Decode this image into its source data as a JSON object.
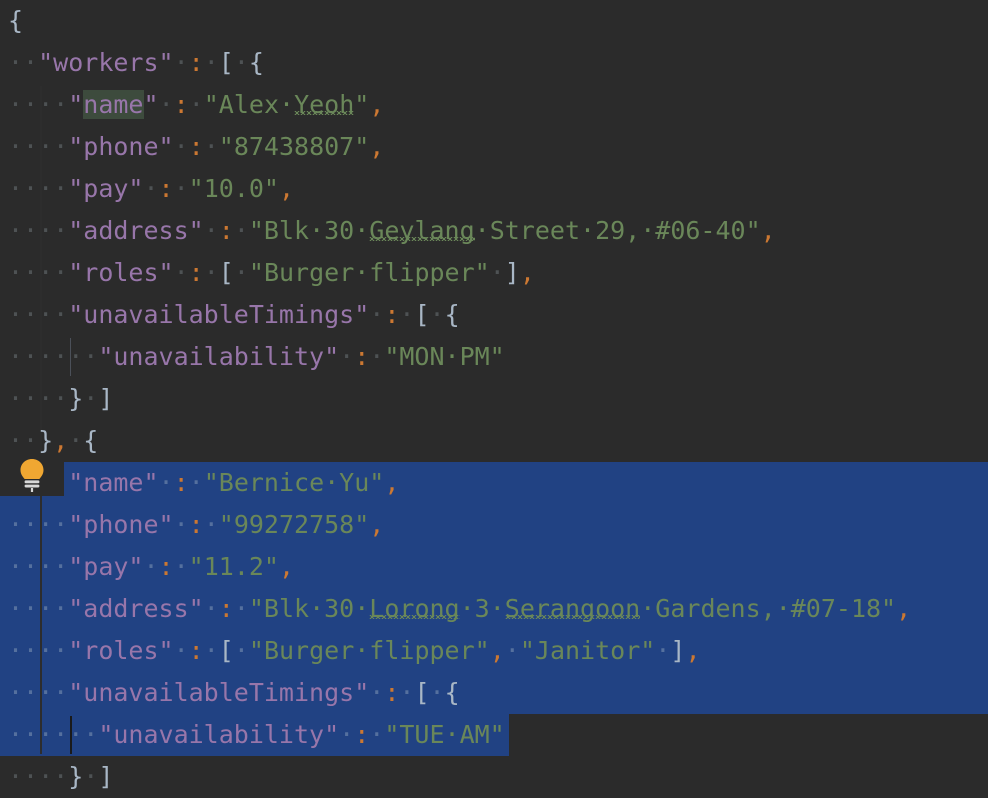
{
  "app": {
    "kind": "json-code-editor",
    "theme": "darcula",
    "background_color": "#2b2b2b",
    "selection_color": "#214283",
    "key_color": "#9876aa",
    "string_color": "#6a8759",
    "punctuation_color": "#cc7832",
    "brace_color": "#a9b7c6",
    "whitespace_dot_color": "#4e5254",
    "identifier_highlight_color": "#3d4b3d",
    "spellcheck_underline_color": "#6a8759",
    "font_size_px": 25,
    "line_height_px": 42
  },
  "gutter": {
    "intention_bulb": {
      "icon": "lightbulb-icon",
      "label": "Show Context Actions",
      "color": "#f0a732",
      "line_index": 11
    }
  },
  "editor": {
    "lines": [
      {
        "index": 0,
        "indent": 0,
        "selected": false,
        "tokens": [
          {
            "t": "brace",
            "v": "{"
          }
        ]
      },
      {
        "index": 1,
        "indent": 1,
        "selected": false,
        "tokens": [
          {
            "t": "key",
            "v": "\"workers\""
          },
          {
            "t": "ws",
            "v": "·"
          },
          {
            "t": "punc",
            "v": ":"
          },
          {
            "t": "ws",
            "v": "·"
          },
          {
            "t": "brace",
            "v": "["
          },
          {
            "t": "ws",
            "v": "·"
          },
          {
            "t": "brace",
            "v": "{"
          }
        ]
      },
      {
        "index": 2,
        "indent": 2,
        "selected": false,
        "tokens": [
          {
            "t": "key",
            "v": "\""
          },
          {
            "t": "key-hl",
            "v": "name"
          },
          {
            "t": "key",
            "v": "\""
          },
          {
            "t": "ws",
            "v": "·"
          },
          {
            "t": "punc",
            "v": ":"
          },
          {
            "t": "ws",
            "v": "·"
          },
          {
            "t": "str",
            "v": "\"Alex·"
          },
          {
            "t": "str-spell",
            "v": "Yeoh"
          },
          {
            "t": "str",
            "v": "\""
          },
          {
            "t": "punc",
            "v": ","
          }
        ]
      },
      {
        "index": 3,
        "indent": 2,
        "selected": false,
        "tokens": [
          {
            "t": "key",
            "v": "\"phone\""
          },
          {
            "t": "ws",
            "v": "·"
          },
          {
            "t": "punc",
            "v": ":"
          },
          {
            "t": "ws",
            "v": "·"
          },
          {
            "t": "str",
            "v": "\"87438807\""
          },
          {
            "t": "punc",
            "v": ","
          }
        ]
      },
      {
        "index": 4,
        "indent": 2,
        "selected": false,
        "tokens": [
          {
            "t": "key",
            "v": "\"pay\""
          },
          {
            "t": "ws",
            "v": "·"
          },
          {
            "t": "punc",
            "v": ":"
          },
          {
            "t": "ws",
            "v": "·"
          },
          {
            "t": "str",
            "v": "\"10.0\""
          },
          {
            "t": "punc",
            "v": ","
          }
        ]
      },
      {
        "index": 5,
        "indent": 2,
        "selected": false,
        "tokens": [
          {
            "t": "key",
            "v": "\"address\""
          },
          {
            "t": "ws",
            "v": "·"
          },
          {
            "t": "punc",
            "v": ":"
          },
          {
            "t": "ws",
            "v": "·"
          },
          {
            "t": "str",
            "v": "\"Blk·30·"
          },
          {
            "t": "str-spell",
            "v": "Geylang"
          },
          {
            "t": "str",
            "v": "·Street·29,·#06-40\""
          },
          {
            "t": "punc",
            "v": ","
          }
        ]
      },
      {
        "index": 6,
        "indent": 2,
        "selected": false,
        "tokens": [
          {
            "t": "key",
            "v": "\"roles\""
          },
          {
            "t": "ws",
            "v": "·"
          },
          {
            "t": "punc",
            "v": ":"
          },
          {
            "t": "ws",
            "v": "·"
          },
          {
            "t": "brace",
            "v": "["
          },
          {
            "t": "ws",
            "v": "·"
          },
          {
            "t": "str",
            "v": "\"Burger·flipper\""
          },
          {
            "t": "ws",
            "v": "·"
          },
          {
            "t": "brace",
            "v": "]"
          },
          {
            "t": "punc",
            "v": ","
          }
        ]
      },
      {
        "index": 7,
        "indent": 2,
        "selected": false,
        "tokens": [
          {
            "t": "key",
            "v": "\"unavailableTimings\""
          },
          {
            "t": "ws",
            "v": "·"
          },
          {
            "t": "punc",
            "v": ":"
          },
          {
            "t": "ws",
            "v": "·"
          },
          {
            "t": "brace",
            "v": "["
          },
          {
            "t": "ws",
            "v": "·"
          },
          {
            "t": "brace",
            "v": "{"
          }
        ]
      },
      {
        "index": 8,
        "indent": 3,
        "selected": false,
        "tokens": [
          {
            "t": "key",
            "v": "\"unavailability\""
          },
          {
            "t": "ws",
            "v": "·"
          },
          {
            "t": "punc",
            "v": ":"
          },
          {
            "t": "ws",
            "v": "·"
          },
          {
            "t": "str",
            "v": "\"MON·PM\""
          }
        ]
      },
      {
        "index": 9,
        "indent": 2,
        "selected": false,
        "tokens": [
          {
            "t": "brace",
            "v": "}"
          },
          {
            "t": "ws",
            "v": "·"
          },
          {
            "t": "brace",
            "v": "]"
          }
        ]
      },
      {
        "index": 10,
        "indent": 1,
        "selected": false,
        "tokens": [
          {
            "t": "brace",
            "v": "}"
          },
          {
            "t": "punc",
            "v": ","
          },
          {
            "t": "ws",
            "v": "·"
          },
          {
            "t": "brace",
            "v": "{"
          }
        ]
      },
      {
        "index": 11,
        "indent": 2,
        "selected": true,
        "tokens": [
          {
            "t": "key",
            "v": "\"name\""
          },
          {
            "t": "ws",
            "v": "·"
          },
          {
            "t": "punc",
            "v": ":"
          },
          {
            "t": "ws",
            "v": "·"
          },
          {
            "t": "str",
            "v": "\"Bernice·Yu\""
          },
          {
            "t": "punc",
            "v": ","
          }
        ]
      },
      {
        "index": 12,
        "indent": 2,
        "selected": true,
        "tokens": [
          {
            "t": "key",
            "v": "\"phone\""
          },
          {
            "t": "ws",
            "v": "·"
          },
          {
            "t": "punc",
            "v": ":"
          },
          {
            "t": "ws",
            "v": "·"
          },
          {
            "t": "str",
            "v": "\"99272758\""
          },
          {
            "t": "punc",
            "v": ","
          }
        ]
      },
      {
        "index": 13,
        "indent": 2,
        "selected": true,
        "tokens": [
          {
            "t": "key",
            "v": "\"pay\""
          },
          {
            "t": "ws",
            "v": "·"
          },
          {
            "t": "punc",
            "v": ":"
          },
          {
            "t": "ws",
            "v": "·"
          },
          {
            "t": "str",
            "v": "\"11.2\""
          },
          {
            "t": "punc",
            "v": ","
          }
        ]
      },
      {
        "index": 14,
        "indent": 2,
        "selected": true,
        "tokens": [
          {
            "t": "key",
            "v": "\"address\""
          },
          {
            "t": "ws",
            "v": "·"
          },
          {
            "t": "punc",
            "v": ":"
          },
          {
            "t": "ws",
            "v": "·"
          },
          {
            "t": "str",
            "v": "\"Blk·30·"
          },
          {
            "t": "str-spell",
            "v": "Lorong"
          },
          {
            "t": "str",
            "v": "·3·"
          },
          {
            "t": "str-spell",
            "v": "Serangoon"
          },
          {
            "t": "str",
            "v": "·Gardens,·#07-18\""
          },
          {
            "t": "punc",
            "v": ","
          }
        ]
      },
      {
        "index": 15,
        "indent": 2,
        "selected": true,
        "tokens": [
          {
            "t": "key",
            "v": "\"roles\""
          },
          {
            "t": "ws",
            "v": "·"
          },
          {
            "t": "punc",
            "v": ":"
          },
          {
            "t": "ws",
            "v": "·"
          },
          {
            "t": "brace",
            "v": "["
          },
          {
            "t": "ws",
            "v": "·"
          },
          {
            "t": "str",
            "v": "\"Burger·flipper\""
          },
          {
            "t": "punc",
            "v": ","
          },
          {
            "t": "ws",
            "v": "·"
          },
          {
            "t": "str",
            "v": "\"Janitor\""
          },
          {
            "t": "ws",
            "v": "·"
          },
          {
            "t": "brace",
            "v": "]"
          },
          {
            "t": "punc",
            "v": ","
          }
        ]
      },
      {
        "index": 16,
        "indent": 2,
        "selected": true,
        "tokens": [
          {
            "t": "key",
            "v": "\"unavailableTimings\""
          },
          {
            "t": "ws",
            "v": "·"
          },
          {
            "t": "punc",
            "v": ":"
          },
          {
            "t": "ws",
            "v": "·"
          },
          {
            "t": "brace",
            "v": "["
          },
          {
            "t": "ws",
            "v": "·"
          },
          {
            "t": "brace",
            "v": "{"
          }
        ]
      },
      {
        "index": 17,
        "indent": 3,
        "selected": true,
        "tokens": [
          {
            "t": "key",
            "v": "\"unavailability\""
          },
          {
            "t": "ws",
            "v": "·"
          },
          {
            "t": "punc",
            "v": ":"
          },
          {
            "t": "ws",
            "v": "·"
          },
          {
            "t": "str",
            "v": "\"TUE·AM\""
          }
        ]
      },
      {
        "index": 18,
        "indent": 2,
        "selected": false,
        "tokens": [
          {
            "t": "brace",
            "v": "}"
          },
          {
            "t": "ws",
            "v": "·"
          },
          {
            "t": "brace",
            "v": "]"
          }
        ]
      }
    ]
  },
  "document_content": {
    "workers": [
      {
        "name": "Alex Yeoh",
        "phone": "87438807",
        "pay": "10.0",
        "address": "Blk 30 Geylang Street 29, #06-40",
        "roles": [
          "Burger flipper"
        ],
        "unavailableTimings": [
          {
            "unavailability": "MON PM"
          }
        ]
      },
      {
        "name": "Bernice Yu",
        "phone": "99272758",
        "pay": "11.2",
        "address": "Blk 30 Lorong 3 Serangoon Gardens, #07-18",
        "roles": [
          "Burger flipper",
          "Janitor"
        ],
        "unavailableTimings": [
          {
            "unavailability": "TUE AM"
          }
        ]
      }
    ]
  }
}
